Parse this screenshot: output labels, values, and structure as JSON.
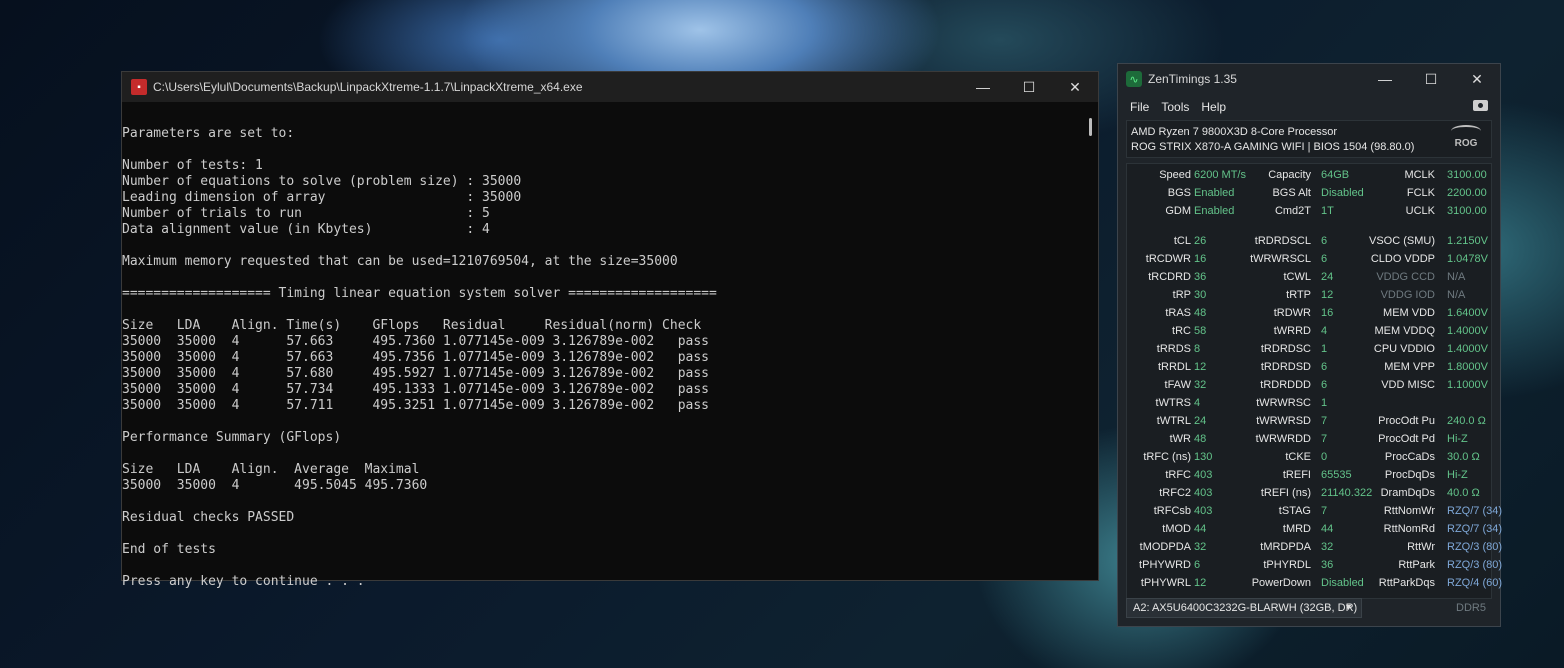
{
  "console": {
    "title": "C:\\Users\\Eylul\\Documents\\Backup\\LinpackXtreme-1.1.7\\LinpackXtreme_x64.exe",
    "lines": [
      "",
      "Parameters are set to:",
      "",
      "Number of tests: 1",
      "Number of equations to solve (problem size) : 35000",
      "Leading dimension of array                  : 35000",
      "Number of trials to run                     : 5",
      "Data alignment value (in Kbytes)            : 4",
      "",
      "Maximum memory requested that can be used=1210769504, at the size=35000",
      "",
      "=================== Timing linear equation system solver ===================",
      "",
      "Size   LDA    Align. Time(s)    GFlops   Residual     Residual(norm) Check",
      "35000  35000  4      57.663     495.7360 1.077145e-009 3.126789e-002   pass",
      "35000  35000  4      57.663     495.7356 1.077145e-009 3.126789e-002   pass",
      "35000  35000  4      57.680     495.5927 1.077145e-009 3.126789e-002   pass",
      "35000  35000  4      57.734     495.1333 1.077145e-009 3.126789e-002   pass",
      "35000  35000  4      57.711     495.3251 1.077145e-009 3.126789e-002   pass",
      "",
      "Performance Summary (GFlops)",
      "",
      "Size   LDA    Align.  Average  Maximal",
      "35000  35000  4       495.5045 495.7360",
      "",
      "Residual checks PASSED",
      "",
      "End of tests",
      "",
      "Press any key to continue . . ."
    ]
  },
  "zen": {
    "title": "ZenTimings 1.35",
    "menu": [
      "File",
      "Tools",
      "Help"
    ],
    "cpu": "AMD Ryzen 7 9800X3D 8-Core Processor",
    "board": "ROG STRIX X870-A GAMING WIFI | BIOS 1504 (98.80.0)",
    "rog": "ROG",
    "rows": [
      [
        [
          "Speed",
          "6200 MT/s"
        ],
        [
          "Capacity",
          "64GB"
        ],
        [
          "MCLK",
          "3100.00"
        ]
      ],
      [
        [
          "BGS",
          "Enabled"
        ],
        [
          "BGS Alt",
          "Disabled"
        ],
        [
          "FCLK",
          "2200.00"
        ]
      ],
      [
        [
          "GDM",
          "Enabled"
        ],
        [
          "Cmd2T",
          "1T"
        ],
        [
          "UCLK",
          "3100.00"
        ]
      ],
      null,
      [
        [
          "tCL",
          "26"
        ],
        [
          "tRDRDSCL",
          "6"
        ],
        [
          "VSOC (SMU)",
          "1.2150V"
        ]
      ],
      [
        [
          "tRCDWR",
          "16"
        ],
        [
          "tWRWRSCL",
          "6"
        ],
        [
          "CLDO VDDP",
          "1.0478V"
        ]
      ],
      [
        [
          "tRCDRD",
          "36"
        ],
        [
          "tCWL",
          "24"
        ],
        [
          "VDDG CCD",
          "N/A"
        ]
      ],
      [
        [
          "tRP",
          "30"
        ],
        [
          "tRTP",
          "12"
        ],
        [
          "VDDG IOD",
          "N/A"
        ]
      ],
      [
        [
          "tRAS",
          "48"
        ],
        [
          "tRDWR",
          "16"
        ],
        [
          "MEM VDD",
          "1.6400V"
        ]
      ],
      [
        [
          "tRC",
          "58"
        ],
        [
          "tWRRD",
          "4"
        ],
        [
          "MEM VDDQ",
          "1.4000V"
        ]
      ],
      [
        [
          "tRRDS",
          "8"
        ],
        [
          "tRDRDSC",
          "1"
        ],
        [
          "CPU VDDIO",
          "1.4000V"
        ]
      ],
      [
        [
          "tRRDL",
          "12"
        ],
        [
          "tRDRDSD",
          "6"
        ],
        [
          "MEM VPP",
          "1.8000V"
        ]
      ],
      [
        [
          "tFAW",
          "32"
        ],
        [
          "tRDRDDD",
          "6"
        ],
        [
          "VDD MISC",
          "1.1000V"
        ]
      ],
      [
        [
          "tWTRS",
          "4"
        ],
        [
          "tWRWRSC",
          "1"
        ],
        [
          "",
          ""
        ]
      ],
      [
        [
          "tWTRL",
          "24"
        ],
        [
          "tWRWRSD",
          "7"
        ],
        [
          "ProcOdt Pu",
          "240.0 Ω"
        ]
      ],
      [
        [
          "tWR",
          "48"
        ],
        [
          "tWRWRDD",
          "7"
        ],
        [
          "ProcOdt Pd",
          "Hi-Z"
        ]
      ],
      [
        [
          "tRFC (ns)",
          "130"
        ],
        [
          "tCKE",
          "0"
        ],
        [
          "ProcCaDs",
          "30.0 Ω"
        ]
      ],
      [
        [
          "tRFC",
          "403"
        ],
        [
          "tREFI",
          "65535"
        ],
        [
          "ProcDqDs",
          "Hi-Z"
        ]
      ],
      [
        [
          "tRFC2",
          "403"
        ],
        [
          "tREFI (ns)",
          "21140.322"
        ],
        [
          "DramDqDs",
          "40.0 Ω"
        ]
      ],
      [
        [
          "tRFCsb",
          "403"
        ],
        [
          "tSTAG",
          "7"
        ],
        [
          "RttNomWr",
          "RZQ/7 (34)"
        ]
      ],
      [
        [
          "tMOD",
          "44"
        ],
        [
          "tMRD",
          "44"
        ],
        [
          "RttNomRd",
          "RZQ/7 (34)"
        ]
      ],
      [
        [
          "tMODPDA",
          "32"
        ],
        [
          "tMRDPDA",
          "32"
        ],
        [
          "RttWr",
          "RZQ/3 (80)"
        ]
      ],
      [
        [
          "tPHYWRD",
          "6"
        ],
        [
          "tPHYRDL",
          "36"
        ],
        [
          "RttPark",
          "RZQ/3 (80)"
        ]
      ],
      [
        [
          "tPHYWRL",
          "12"
        ],
        [
          "PowerDown",
          "Disabled"
        ],
        [
          "RttParkDqs",
          "RZQ/4 (60)"
        ]
      ]
    ],
    "dimm": "A2: AX5U6400C3232G-BLARWH (32GB, DR)",
    "memtype": "DDR5"
  }
}
